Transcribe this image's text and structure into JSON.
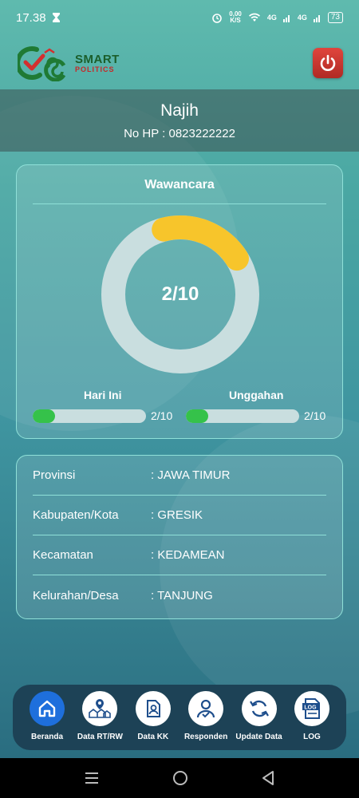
{
  "status_bar": {
    "time": "17.38",
    "net_speed_value": "0,00",
    "net_speed_unit": "K/S",
    "signal_1": "4G",
    "signal_2": "4G",
    "battery": "73"
  },
  "header": {
    "logo_line1": "SMART",
    "logo_line2": "POLITICS",
    "power_icon": "power-icon"
  },
  "user": {
    "name": "Najih",
    "phone": "No HP : 0823222222"
  },
  "interview": {
    "title": "Wawancara",
    "center_label": "2/10",
    "progress": 0.2,
    "today_label": "Hari Ini",
    "today_value": "2/10",
    "today_progress": 0.2,
    "upload_label": "Unggahan",
    "upload_value": "2/10",
    "upload_progress": 0.2,
    "colors": {
      "ring_track": "#c9dedf",
      "ring_fill": "#f7c52b",
      "bar_fill": "#35c24a"
    }
  },
  "location": {
    "rows": [
      {
        "key": "Provinsi",
        "value": ": JAWA TIMUR"
      },
      {
        "key": "Kabupaten/Kota",
        "value": ": GRESIK"
      },
      {
        "key": "Kecamatan",
        "value": ": KEDAMEAN"
      },
      {
        "key": "Kelurahan/Desa",
        "value": ": TANJUNG"
      }
    ]
  },
  "nav": {
    "items": [
      {
        "label": "Beranda",
        "icon": "home-icon",
        "active": true
      },
      {
        "label": "Data RT/RW",
        "icon": "houses-icon",
        "active": false
      },
      {
        "label": "Data KK",
        "icon": "family-card-icon",
        "active": false
      },
      {
        "label": "Responden",
        "icon": "user-check-icon",
        "active": false
      },
      {
        "label": "Update Data",
        "icon": "sync-icon",
        "active": false
      },
      {
        "label": "LOG",
        "icon": "log-file-icon",
        "active": false
      }
    ]
  },
  "log_icon_text": "LOG"
}
